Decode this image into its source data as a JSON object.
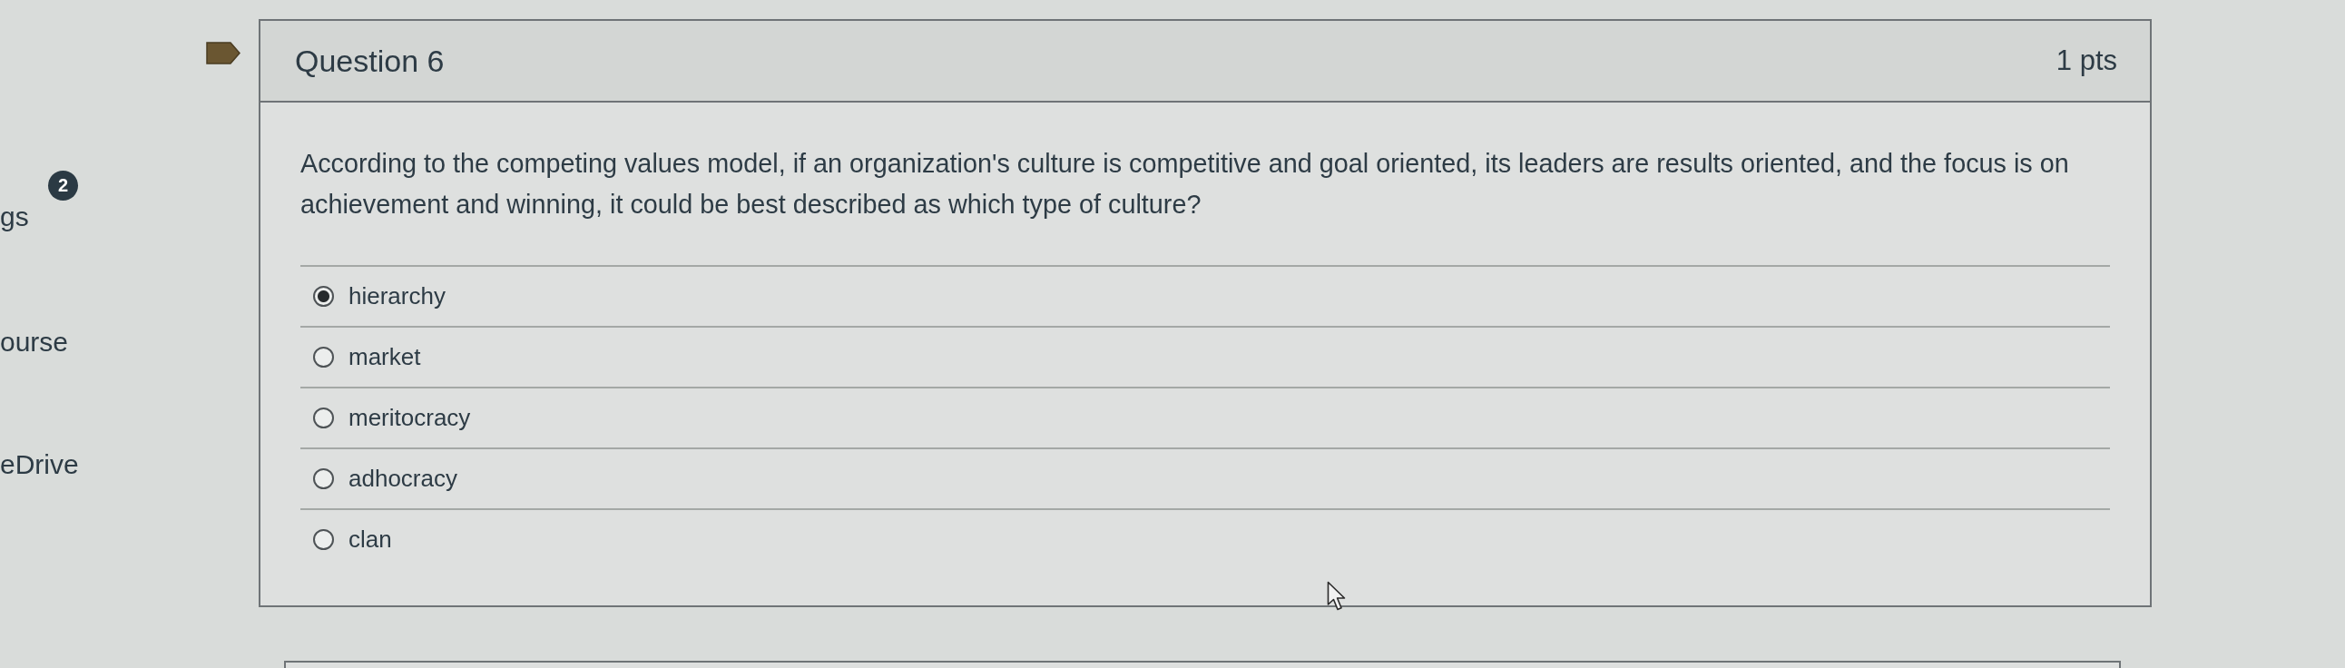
{
  "sidebar": {
    "badge": "2",
    "items": [
      {
        "label": "gs"
      },
      {
        "label": "ourse"
      },
      {
        "label": "eDrive"
      }
    ]
  },
  "question": {
    "title": "Question 6",
    "points": "1 pts",
    "text": "According to the competing values model, if an organization's culture is competitive and goal oriented, its leaders are results oriented, and the focus is on achievement and winning, it could be best described as which type of culture?",
    "answers": [
      {
        "label": "hierarchy",
        "selected": true
      },
      {
        "label": "market",
        "selected": false
      },
      {
        "label": "meritocracy",
        "selected": false
      },
      {
        "label": "adhocracy",
        "selected": false
      },
      {
        "label": "clan",
        "selected": false
      }
    ]
  }
}
